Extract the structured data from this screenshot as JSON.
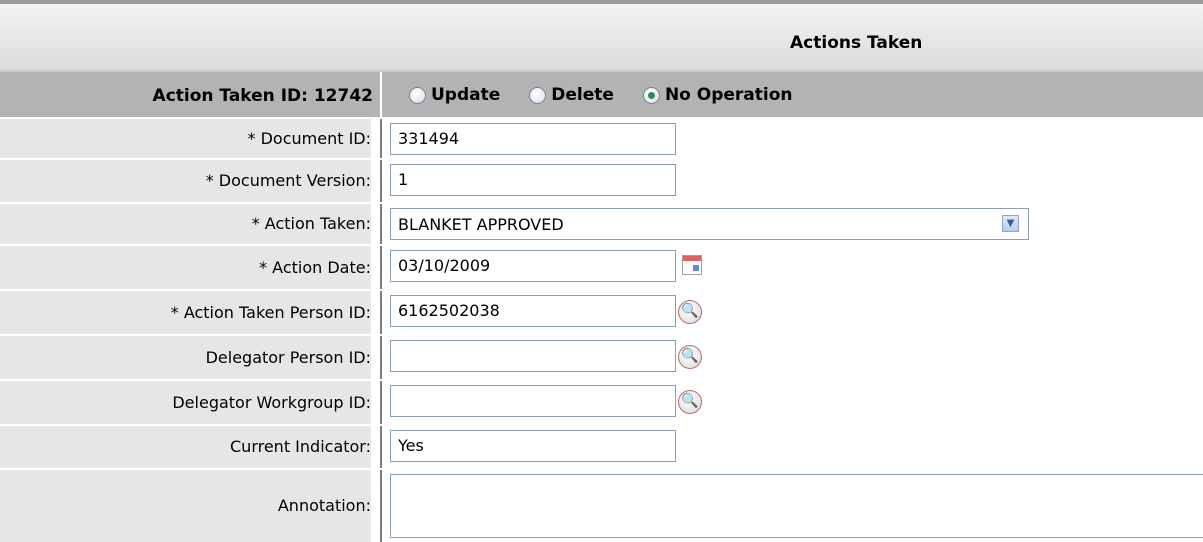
{
  "header": {
    "title": "Actions Taken"
  },
  "id_row": {
    "label": "Action Taken ID: 12742",
    "options": [
      "Update",
      "Delete",
      "No Operation"
    ],
    "selected": "No Operation"
  },
  "fields": {
    "document_id": {
      "label": "* Document ID:",
      "value": "331494"
    },
    "document_version": {
      "label": "* Document Version:",
      "value": "1"
    },
    "action_taken": {
      "label": "* Action Taken:",
      "value": "BLANKET APPROVED"
    },
    "action_date": {
      "label": "* Action Date:",
      "value": "03/10/2009"
    },
    "action_person_id": {
      "label": "* Action Taken Person ID:",
      "value": "6162502038"
    },
    "delegator_person_id": {
      "label": "Delegator Person ID:",
      "value": ""
    },
    "delegator_workgroup_id": {
      "label": "Delegator Workgroup ID:",
      "value": ""
    },
    "current_indicator": {
      "label": "Current Indicator:",
      "value": "Yes"
    },
    "annotation": {
      "label": "Annotation:",
      "value": ""
    }
  },
  "icons": {
    "calendar": "calendar-icon",
    "lookup": "magnifier-lookup-icon",
    "dropdown": "chevron-down-icon"
  },
  "colors": {
    "label_bg": "#e6e6e6",
    "id_row_bg": "#b3b3b3",
    "radio_checked": "#2e8b57"
  }
}
